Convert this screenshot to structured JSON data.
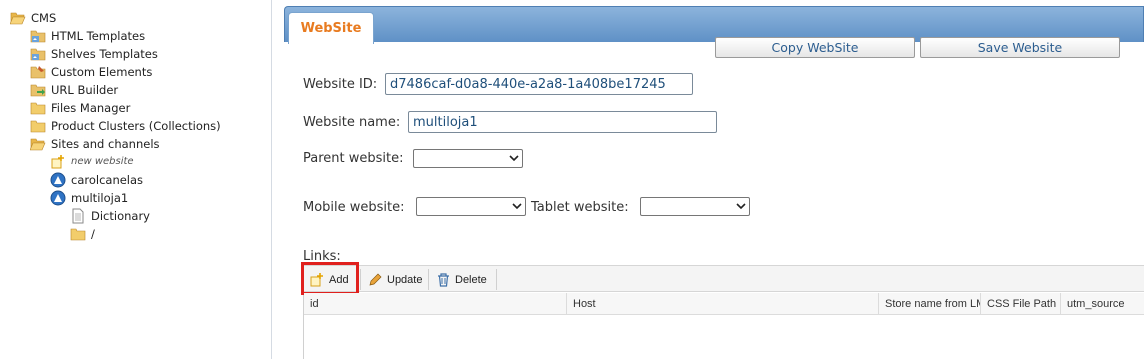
{
  "tree": {
    "items": [
      {
        "label": "CMS",
        "icon": "folder-open-icon"
      },
      {
        "label": "HTML Templates",
        "icon": "template-icon"
      },
      {
        "label": "Shelves Templates",
        "icon": "template-icon"
      },
      {
        "label": "Custom Elements",
        "icon": "custom-elements-icon"
      },
      {
        "label": "URL Builder",
        "icon": "url-builder-icon"
      },
      {
        "label": "Files Manager",
        "icon": "folder-icon"
      },
      {
        "label": "Product Clusters (Collections)",
        "icon": "folder-icon"
      },
      {
        "label": "Sites and channels",
        "icon": "folder-open-icon"
      },
      {
        "label": "new website",
        "icon": "new-item-icon"
      },
      {
        "label": "carolcanelas",
        "icon": "website-icon"
      },
      {
        "label": "multiloja1",
        "icon": "website-icon"
      },
      {
        "label": "Dictionary",
        "icon": "document-icon"
      },
      {
        "label": "/",
        "icon": "folder-icon"
      }
    ]
  },
  "main": {
    "tab_label": "WebSite",
    "copy_button": "Copy WebSite",
    "save_button": "Save Website",
    "website_id_label": "Website ID:",
    "website_id_value": "d7486caf-d0a8-440e-a2a8-1a408be17245",
    "website_name_label": "Website name:",
    "website_name_value": "multiloja1",
    "parent_label": "Parent website:",
    "parent_value": "",
    "mobile_label": "Mobile website:",
    "mobile_value": "",
    "tablet_label": "Tablet website:",
    "tablet_value": "",
    "links_label": "Links:",
    "toolbar": {
      "add": "Add",
      "update": "Update",
      "delete": "Delete"
    },
    "columns": [
      "id",
      "Host",
      "Store name from LM",
      "CSS File Path",
      "utm_source"
    ]
  },
  "colors": {
    "accent_orange": "#e87b20",
    "tab_bar_blue": "#6b9bcf",
    "highlight_red": "#e0201d",
    "link_blue": "#2c5d8f"
  }
}
